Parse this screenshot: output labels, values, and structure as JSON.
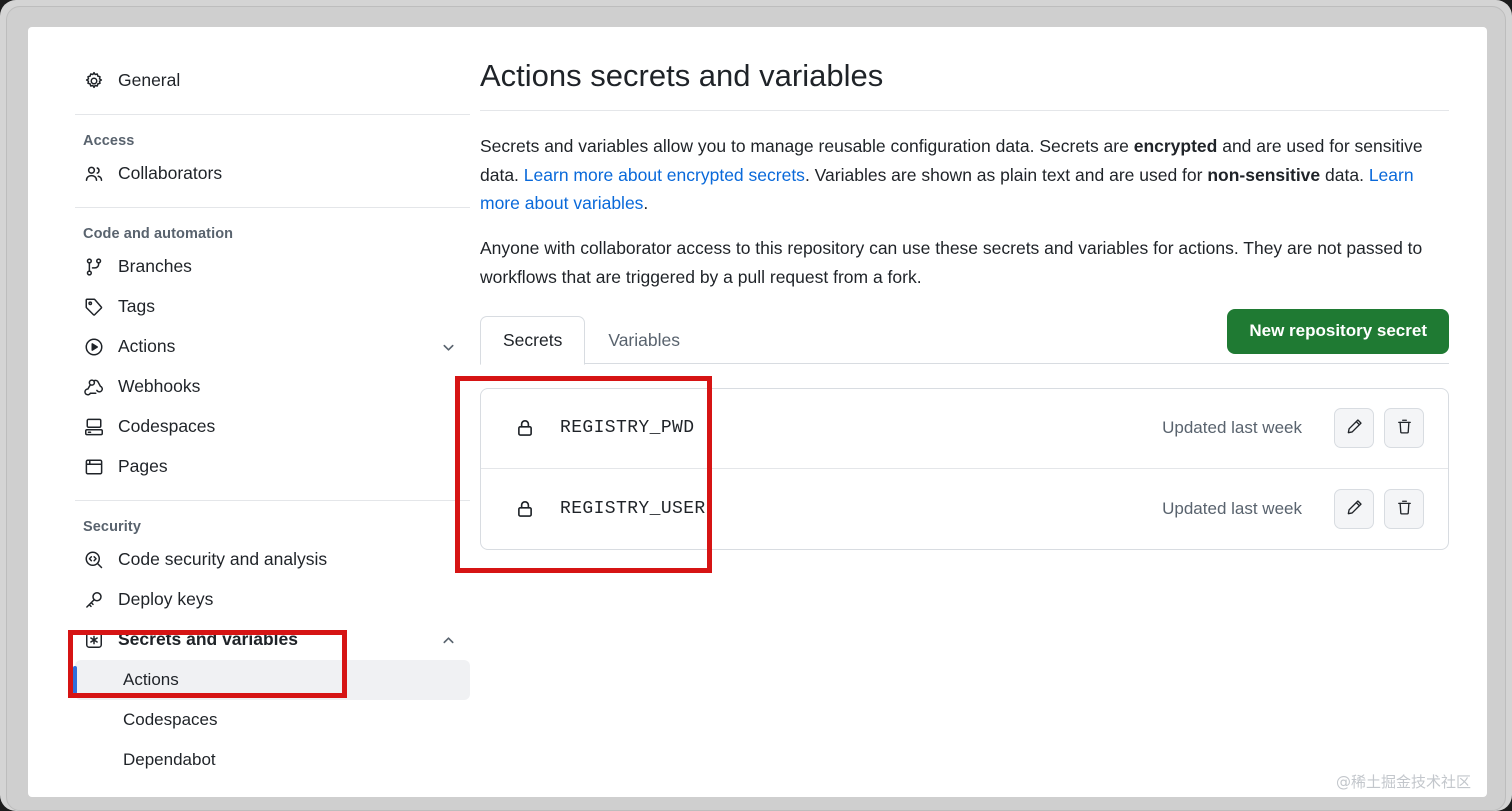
{
  "sidebar": {
    "groups": [
      {
        "title": null,
        "items": [
          {
            "label": "General",
            "icon": "gear-icon",
            "name": "general"
          }
        ]
      },
      {
        "title": "Access",
        "items": [
          {
            "label": "Collaborators",
            "icon": "people-icon",
            "name": "collaborators"
          }
        ]
      },
      {
        "title": "Code and automation",
        "items": [
          {
            "label": "Branches",
            "icon": "branch-icon",
            "name": "branches"
          },
          {
            "label": "Tags",
            "icon": "tag-icon",
            "name": "tags"
          },
          {
            "label": "Actions",
            "icon": "play-circle-icon",
            "name": "actions",
            "chevron": "chevron-down"
          },
          {
            "label": "Webhooks",
            "icon": "webhook-icon",
            "name": "webhooks"
          },
          {
            "label": "Codespaces",
            "icon": "codespaces-icon",
            "name": "codespaces"
          },
          {
            "label": "Pages",
            "icon": "browser-icon",
            "name": "pages"
          }
        ]
      },
      {
        "title": "Security",
        "items": [
          {
            "label": "Code security and analysis",
            "icon": "code-scan-icon",
            "name": "code-security-and-analysis"
          },
          {
            "label": "Deploy keys",
            "icon": "key-icon",
            "name": "deploy-keys"
          },
          {
            "label": "Secrets and variables",
            "icon": "asterisk-box-icon",
            "name": "secrets-and-variables",
            "chevron": "chevron-up",
            "bold": true,
            "subitems": [
              {
                "label": "Actions",
                "name": "secrets-actions",
                "selected": true
              },
              {
                "label": "Codespaces",
                "name": "secrets-codespaces",
                "selected": false
              },
              {
                "label": "Dependabot",
                "name": "secrets-dependabot",
                "selected": false
              }
            ]
          }
        ]
      }
    ]
  },
  "main": {
    "title": "Actions secrets and variables",
    "paragraph1": {
      "part1": "Secrets and variables allow you to manage reusable configuration data. Secrets are ",
      "bold1": "encrypted",
      "part2": " and are used for sensitive data. ",
      "link1": "Learn more about encrypted secrets",
      "part3": ". Variables are shown as plain text and are used for ",
      "bold2": "non-sensitive",
      "part4": " data. ",
      "link2": "Learn more about variables",
      "part5": "."
    },
    "paragraph2": "Anyone with collaborator access to this repository can use these secrets and variables for actions. They are not passed to workflows that are triggered by a pull request from a fork.",
    "tabs": [
      {
        "label": "Secrets",
        "name": "tab-secrets",
        "active": true
      },
      {
        "label": "Variables",
        "name": "tab-variables",
        "active": false
      }
    ],
    "new_secret_button": "New repository secret",
    "secrets": [
      {
        "name": "REGISTRY_PWD",
        "updated": "Updated last week",
        "edit_label": "Edit",
        "delete_label": "Delete"
      },
      {
        "name": "REGISTRY_USER",
        "updated": "Updated last week",
        "edit_label": "Edit",
        "delete_label": "Delete"
      }
    ]
  },
  "watermark": "@稀土掘金技术社区",
  "colors": {
    "accent_green": "#1f7a33",
    "link_blue": "#0969da",
    "annotation_red": "#d61414",
    "selected_bar_blue": "#2f6fdb"
  }
}
